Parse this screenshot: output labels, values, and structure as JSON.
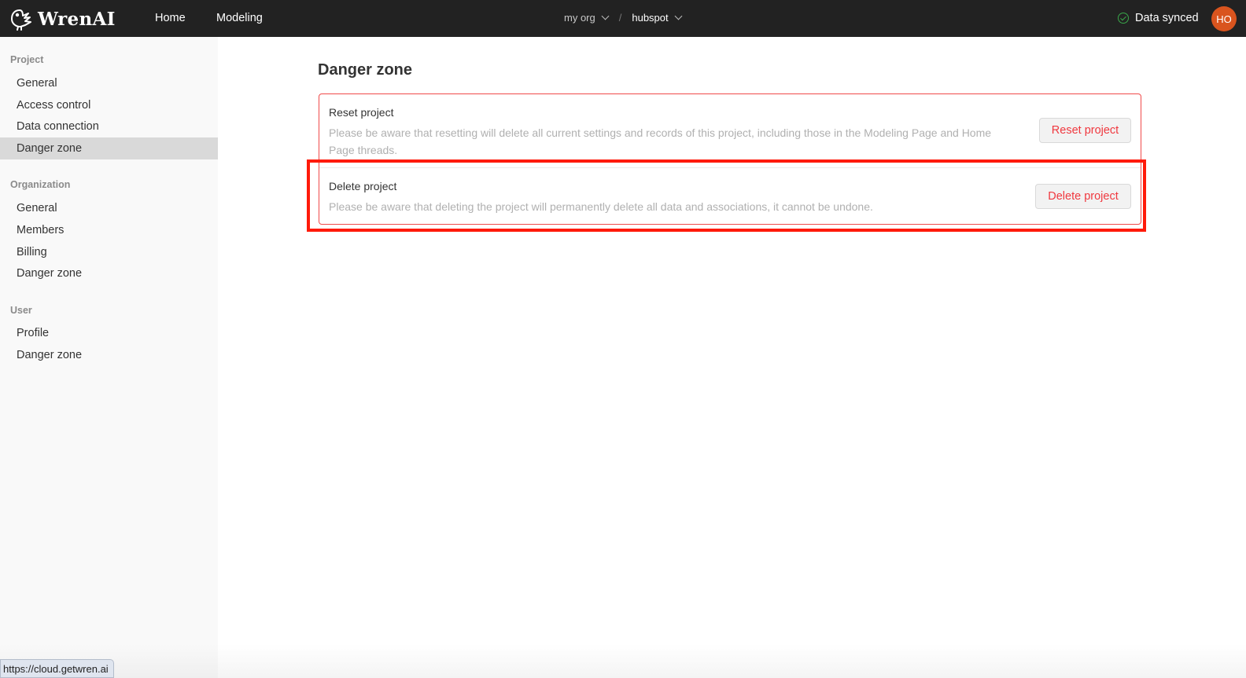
{
  "app": {
    "brand": "WrenAI",
    "logo_icon": "wren-bird-icon"
  },
  "header": {
    "nav": [
      {
        "label": "Home"
      },
      {
        "label": "Modeling"
      }
    ],
    "breadcrumb": {
      "org": "my org",
      "separator": "/",
      "project": "hubspot"
    },
    "sync_status": "Data synced",
    "avatar_initials": "HO",
    "colors": {
      "bar": "#222222",
      "sync_ok": "#3aa84a",
      "avatar": "#d9541e"
    }
  },
  "sidebar": {
    "sections": [
      {
        "heading": "Project",
        "items": [
          {
            "label": "General"
          },
          {
            "label": "Access control"
          },
          {
            "label": "Data connection"
          },
          {
            "label": "Danger zone",
            "active": true
          }
        ]
      },
      {
        "heading": "Organization",
        "items": [
          {
            "label": "General"
          },
          {
            "label": "Members"
          },
          {
            "label": "Billing"
          },
          {
            "label": "Danger zone"
          }
        ]
      },
      {
        "heading": "User",
        "items": [
          {
            "label": "Profile"
          },
          {
            "label": "Danger zone"
          }
        ]
      }
    ]
  },
  "main": {
    "title": "Danger zone",
    "reset": {
      "title": "Reset project",
      "description": "Please be aware that resetting will delete all current settings and records of this project, including those in the Modeling Page and Home Page threads.",
      "button": "Reset project"
    },
    "delete": {
      "title": "Delete project",
      "description": "Please be aware that deleting the project will permanently delete all data and associations, it cannot be undone.",
      "button": "Delete project"
    },
    "colors": {
      "danger": "#f0383f",
      "highlight": "#ff1a0a"
    }
  },
  "status_bar": {
    "url": "https://cloud.getwren.ai"
  }
}
